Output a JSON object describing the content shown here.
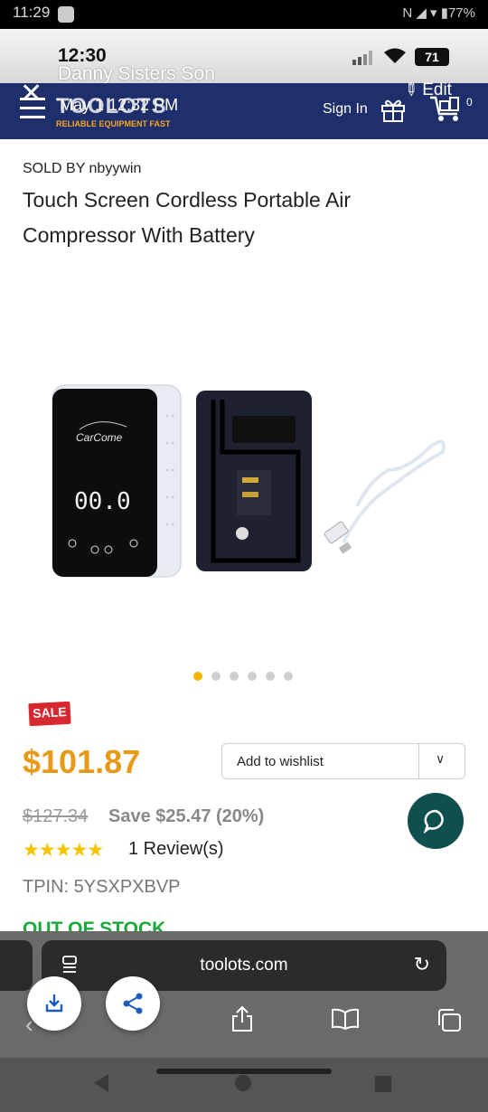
{
  "system_bar": {
    "time": "11:29",
    "status_text": "N ◢ ▾ ▮77%"
  },
  "overlay": {
    "time": "12:30",
    "caller": "Danny Sisters Son",
    "battery": "71"
  },
  "header": {
    "logo_name": "TOOLOTS",
    "logo_tagline": "RELIABLE EQUIPMENT FAST",
    "timestamp_overlay": "May 1 12:32 PM",
    "sign_in": "Sign In",
    "edit": "Edit",
    "cart_count": "0"
  },
  "product": {
    "sold_by_label": "SOLD BY",
    "seller": "nbyywin",
    "title": "Touch Screen Cordless Portable Air Compressor With Battery",
    "image_brand": "CarCome",
    "image_display": "00.0",
    "carousel_total": 6,
    "carousel_active": 1,
    "sale_badge": "SALE",
    "price": "$101.87",
    "old_price": "$127.34",
    "save_text": "Save $25.47 (20%)",
    "rating": 5,
    "stars": "★★★★★",
    "reviews": "1 Review(s)",
    "tpin": "TPIN: 5YSXPXBVP",
    "stock_status": "OUT OF STOCK"
  },
  "wishlist": {
    "label": "Add to wishlist",
    "chevron": "∨"
  },
  "browser": {
    "url": "toolots.com"
  },
  "colors": {
    "brand_navy": "#1f2f6b",
    "price_orange": "#e89a16",
    "sale_red": "#d7282f",
    "chat_teal": "#0f4f4d",
    "stock_green": "#1ba83a",
    "star_yellow": "#f5c400"
  }
}
